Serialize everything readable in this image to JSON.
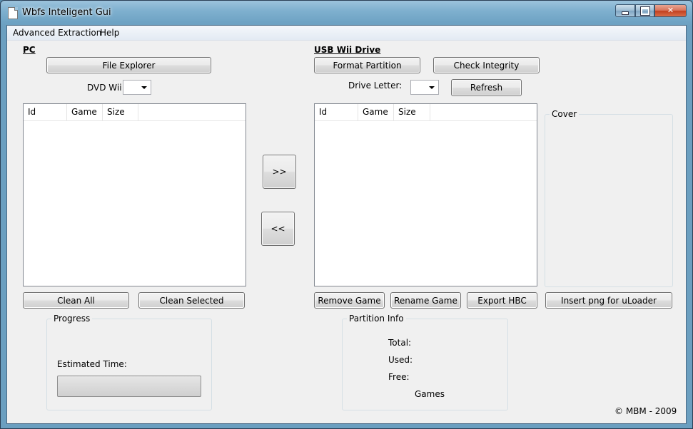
{
  "window": {
    "title": "Wbfs Inteligent Gui",
    "close_glyph": "✕"
  },
  "menu": [
    {
      "label": "Advanced Extraction"
    },
    {
      "label": "Help"
    }
  ],
  "pc": {
    "title": "PC",
    "file_explorer_label": "File Explorer",
    "dvd_label": "DVD Wii:",
    "dvd_value": "",
    "columns": [
      "Id",
      "Game",
      "Size"
    ],
    "clean_all_label": "Clean All",
    "clean_selected_label": "Clean Selected"
  },
  "transfer": {
    "to_usb_label": ">>",
    "to_pc_label": "<<"
  },
  "usb": {
    "title": "USB Wii Drive",
    "format_partition_label": "Format Partition",
    "check_integrity_label": "Check Integrity",
    "drive_letter_label": "Drive Letter:",
    "drive_letter_value": "",
    "refresh_label": "Refresh",
    "columns": [
      "Id",
      "Game",
      "Size"
    ],
    "remove_game_label": "Remove Game",
    "rename_game_label": "Rename Game",
    "export_hbc_label": "Export HBC"
  },
  "cover": {
    "title": "Cover",
    "insert_png_label": "Insert png for uLoader"
  },
  "progress": {
    "title": "Progress",
    "estimated_time_label": "Estimated Time:",
    "value": 0
  },
  "partition_info": {
    "title": "Partition Info",
    "total_label": "Total:",
    "used_label": "Used:",
    "free_label": "Free:",
    "games_label": "Games"
  },
  "copyright": "© MBM - 2009"
}
